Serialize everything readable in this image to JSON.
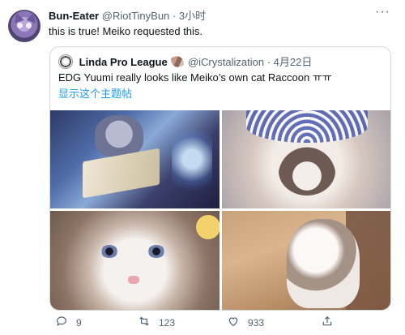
{
  "tweet": {
    "author_name": "Bun-Eater",
    "author_handle": "@RiotTinyBun",
    "separator": "·",
    "time": "3小时",
    "text": "this is true! Meiko requested this.",
    "more_label": "···"
  },
  "quote": {
    "author_name": "Linda Pro League",
    "author_handle": "@iCrystalization",
    "separator": "·",
    "date": "4月22日",
    "text": "EDG Yuumi really looks like Meiko’s own cat Raccoon ㅠㅠ",
    "translate_link": "显示这个主题帖"
  },
  "actions": {
    "reply_count": "9",
    "retweet_count": "123",
    "like_count": "933"
  },
  "colors": {
    "link": "#1d9bf0",
    "secondary_text": "#536471",
    "border": "#cfd9de"
  },
  "icons": [
    "reply-icon",
    "retweet-icon",
    "like-icon",
    "share-icon",
    "more-icon"
  ]
}
